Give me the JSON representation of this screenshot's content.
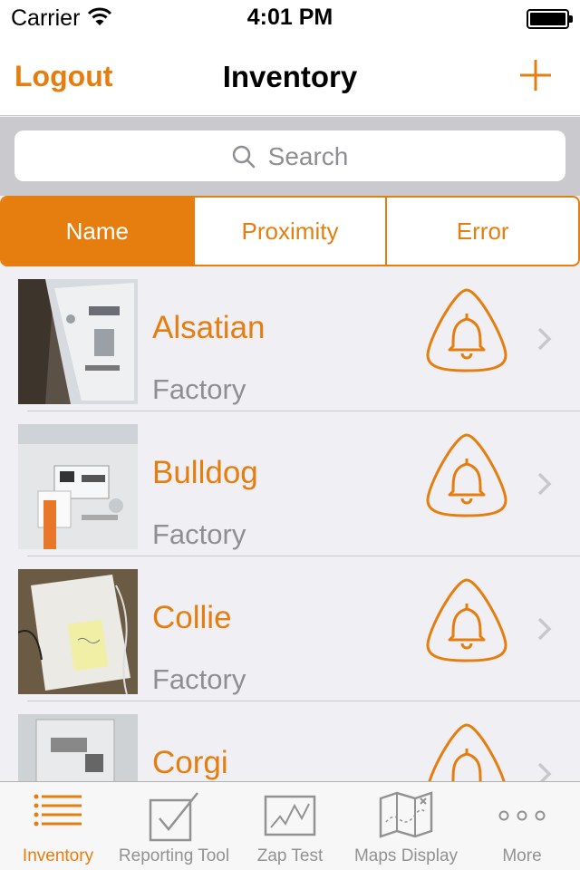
{
  "status_bar": {
    "carrier": "Carrier",
    "time": "4:01 PM"
  },
  "nav": {
    "left_button": "Logout",
    "title": "Inventory",
    "right_icon": "plus-icon"
  },
  "search": {
    "placeholder": "Search"
  },
  "segments": [
    {
      "label": "Name",
      "selected": true
    },
    {
      "label": "Proximity",
      "selected": false
    },
    {
      "label": "Error",
      "selected": false
    }
  ],
  "rows": [
    {
      "name": "Alsatian",
      "subtitle": "Factory"
    },
    {
      "name": "Bulldog",
      "subtitle": "Factory"
    },
    {
      "name": "Collie",
      "subtitle": "Factory"
    },
    {
      "name": "Corgi",
      "subtitle": ""
    }
  ],
  "tabs": [
    {
      "label": "Inventory",
      "icon": "list-icon",
      "active": true
    },
    {
      "label": "Reporting Tool",
      "icon": "checkbox-icon",
      "active": false
    },
    {
      "label": "Zap Test",
      "icon": "line-graph-icon",
      "active": false
    },
    {
      "label": "Maps Display",
      "icon": "map-icon",
      "active": false
    },
    {
      "label": "More",
      "icon": "more-icon",
      "active": false
    }
  ],
  "colors": {
    "accent": "#e67e0f",
    "secondary_text": "#8e8e93",
    "background": "#efeff4"
  }
}
